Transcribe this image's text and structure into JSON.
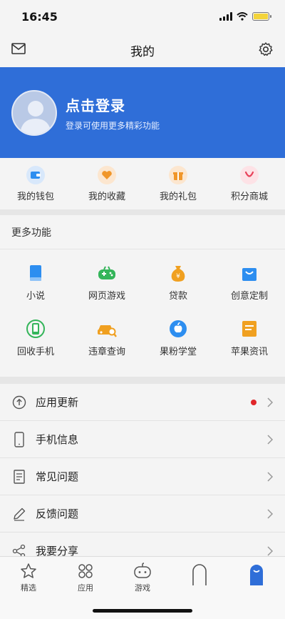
{
  "status_bar": {
    "time": "16:45"
  },
  "nav": {
    "title": "我的"
  },
  "profile": {
    "login_title": "点击登录",
    "login_subtitle": "登录可使用更多精彩功能"
  },
  "quick_actions": [
    {
      "label": "我的钱包",
      "icon": "wallet-icon",
      "color": "#2d8ef0"
    },
    {
      "label": "我的收藏",
      "icon": "heart-icon",
      "color": "#f0962a"
    },
    {
      "label": "我的礼包",
      "icon": "gift-icon",
      "color": "#f0962a"
    },
    {
      "label": "积分商城",
      "icon": "points-mall-icon",
      "color": "#e8425a"
    }
  ],
  "more": {
    "title": "更多功能",
    "items": [
      {
        "label": "小说",
        "icon": "book-icon",
        "color": "#2d8ef0"
      },
      {
        "label": "网页游戏",
        "icon": "gamepad-icon",
        "color": "#34b55a"
      },
      {
        "label": "贷款",
        "icon": "money-bag-icon",
        "color": "#f0a020"
      },
      {
        "label": "创意定制",
        "icon": "shopping-bag-icon",
        "color": "#2d8ef0"
      },
      {
        "label": "回收手机",
        "icon": "phone-recycle-icon",
        "color": "#34b55a"
      },
      {
        "label": "违章查询",
        "icon": "car-search-icon",
        "color": "#f0a020"
      },
      {
        "label": "果粉学堂",
        "icon": "apple-icon",
        "color": "#2d8ef0"
      },
      {
        "label": "苹果资讯",
        "icon": "news-icon",
        "color": "#f0a020"
      }
    ]
  },
  "menu": [
    {
      "label": "应用更新",
      "icon": "update-arrow-icon"
    },
    {
      "label": "手机信息",
      "icon": "phone-icon"
    },
    {
      "label": "常见问题",
      "icon": "document-icon"
    },
    {
      "label": "反馈问题",
      "icon": "pencil-icon"
    },
    {
      "label": "我要分享",
      "icon": "share-icon"
    }
  ],
  "tabs": [
    {
      "label": "精选",
      "icon": "star-icon"
    },
    {
      "label": "应用",
      "icon": "apps-icon"
    },
    {
      "label": "游戏",
      "icon": "game-icon"
    },
    {
      "label": "",
      "icon": "tab-icon"
    },
    {
      "label": "",
      "icon": "tab-icon-active"
    }
  ]
}
